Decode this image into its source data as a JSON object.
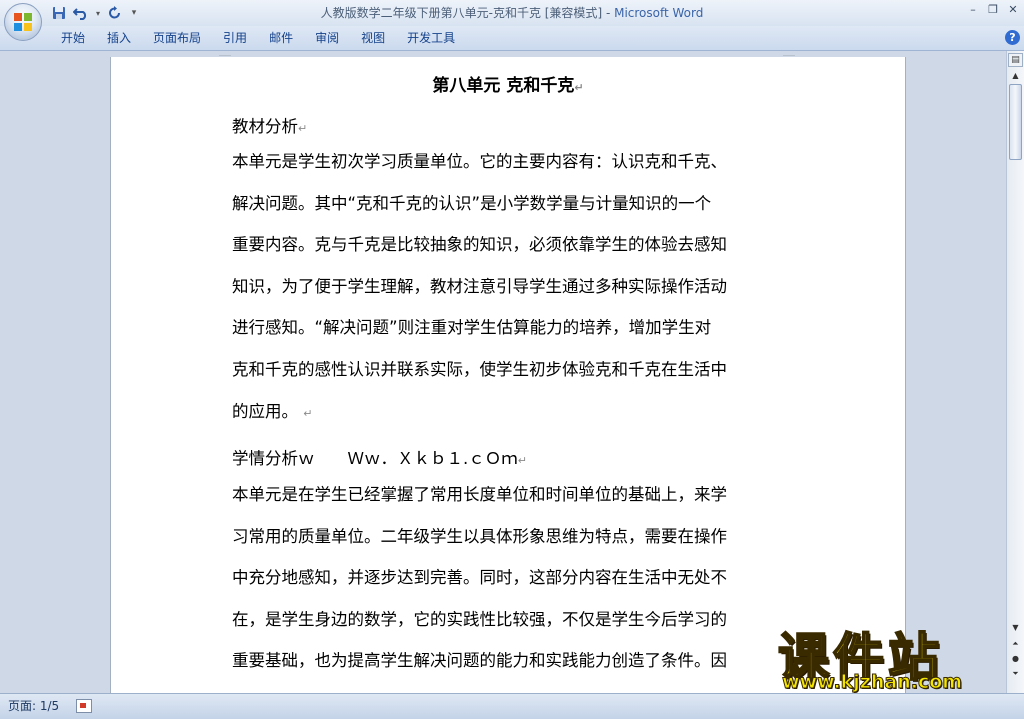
{
  "window": {
    "doc_name": "人教版数学二年级下册第八单元-克和千克 [兼容模式]",
    "separator": " - ",
    "app_name": "Microsoft Word"
  },
  "quick_access": [
    "save-icon",
    "undo-icon",
    "redo-icon",
    "customize-icon"
  ],
  "ribbon": {
    "tabs": [
      "开始",
      "插入",
      "页面布局",
      "引用",
      "邮件",
      "审阅",
      "视图",
      "开发工具"
    ],
    "help_label": "?"
  },
  "document": {
    "title": "第八单元 克和千克",
    "heading1": "教材分析",
    "para1": [
      "本单元是学生初次学习质量单位。它的主要内容有：认识克和千克、",
      "解决问题。其中“克和千克的认识”是小学数学量与计量知识的一个",
      "重要内容。克与千克是比较抽象的知识，必须依靠学生的体验去感知",
      "知识，为了便于学生理解，教材注意引导学生通过多种实际操作活动",
      "进行感知。“解决问题”则注重对学生估算能力的培养，增加学生对",
      "克和千克的感性认识并联系实际，使学生初步体验克和千克在生活中",
      "的应用。"
    ],
    "heading2": "学情分析ｗ　　Ｗｗ．Ｘｋｂ１.ｃＯｍ",
    "para2": [
      "本单元是在学生已经掌握了常用长度单位和时间单位的基础上，来学",
      "习常用的质量单位。二年级学生以具体形象思维为特点，需要在操作",
      "中充分地感知，并逐步达到完善。同时，这部分内容在生活中无处不",
      "在，是学生身边的数学，它的实践性比较强，不仅是学生今后学习的",
      "重要基础，也为提高学生解决问题的能力和实践能力创造了条件。因"
    ],
    "paragraph_mark": "↵"
  },
  "status": {
    "page": "页面: 1/5"
  },
  "watermark": {
    "big": "课件站",
    "small": "www.kjzhan.com"
  }
}
